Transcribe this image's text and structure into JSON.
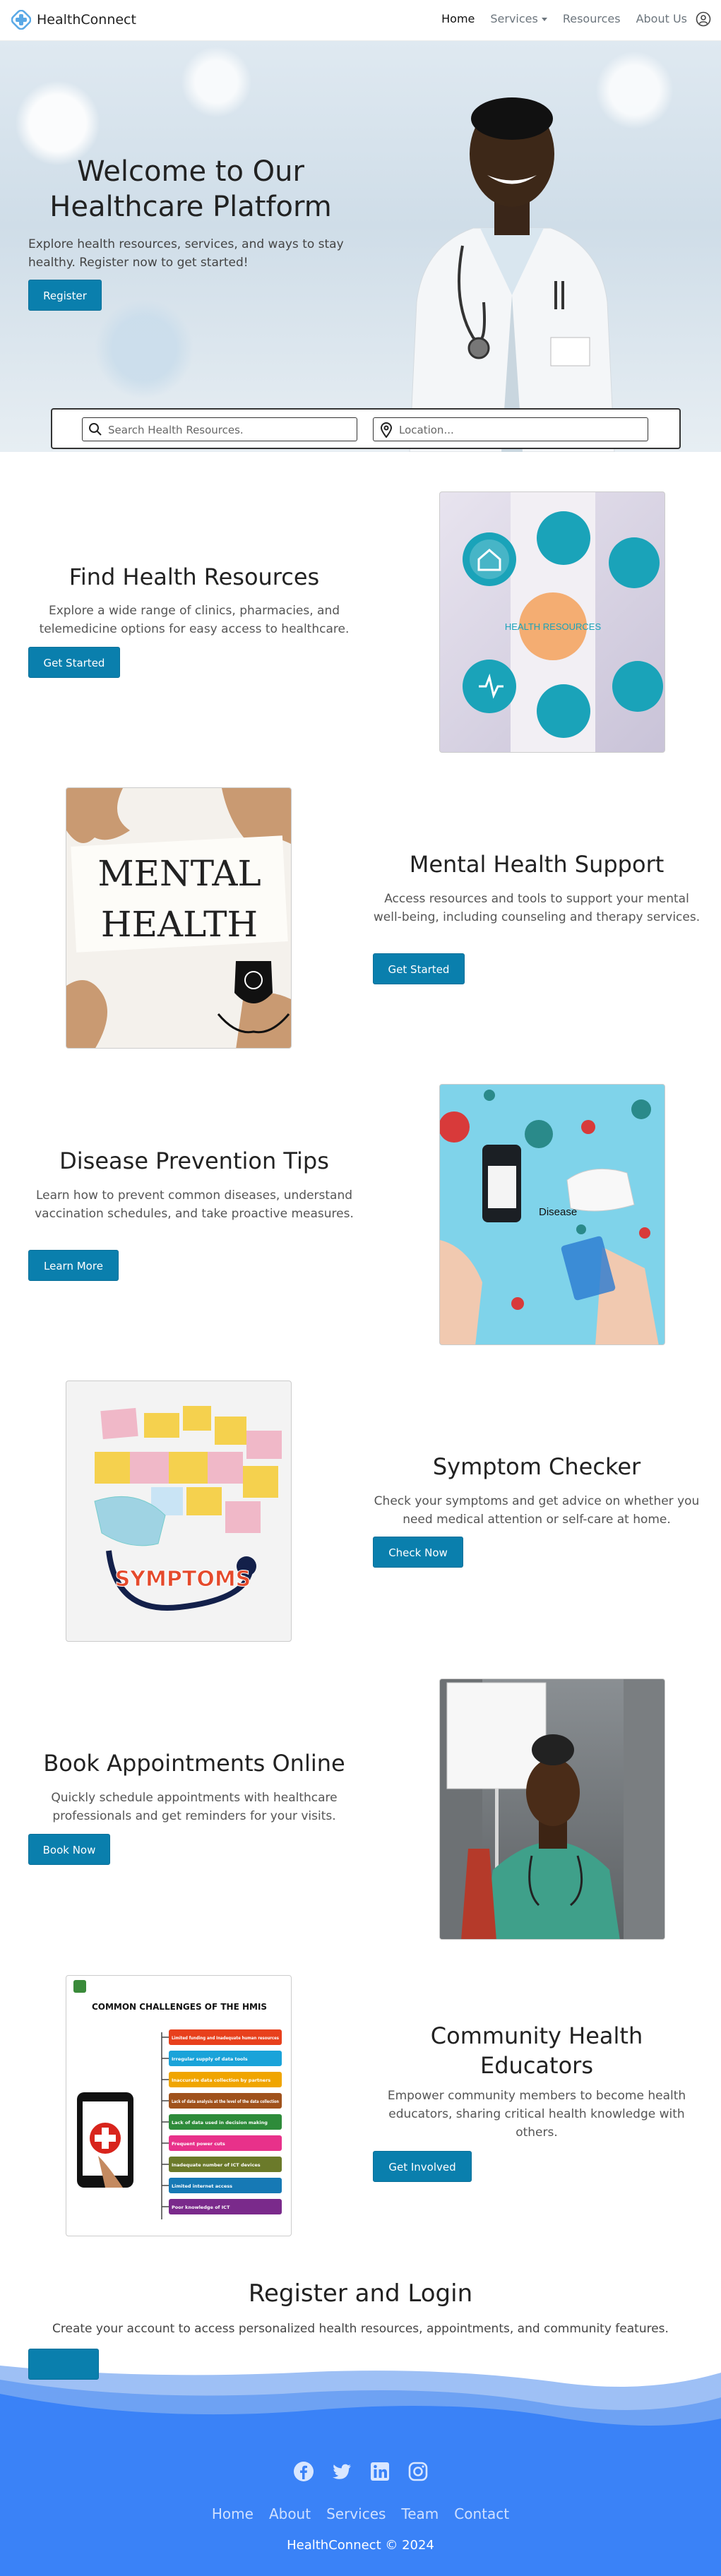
{
  "navbar": {
    "brand": "HealthConnect",
    "links": [
      "Home",
      "Services",
      "Resources",
      "About Us"
    ]
  },
  "hero": {
    "title": "Welcome to Our Healthcare Platform",
    "subtitle": "Explore health resources, services, and ways to stay healthy. Register now to get started!",
    "button": "Register"
  },
  "search": {
    "placeholder": "Search Health Resources.",
    "location_placeholder": "Location..."
  },
  "sections": [
    {
      "title": "Find Health Resources",
      "text": "Explore a wide range of clinics, pharmacies, and telemedicine options for easy access to healthcare.",
      "button": "Get Started",
      "image_caption": "HEALTH RESOURCES"
    },
    {
      "title": "Mental Health Support",
      "text": "Access resources and tools to support your mental well-being, including counseling and therapy services.",
      "button": "Get Started",
      "image_caption_1": "MENTAL",
      "image_caption_2": "HEALTH"
    },
    {
      "title": "Disease Prevention Tips",
      "text": "Learn how to prevent common diseases, understand vaccination schedules, and take proactive measures.",
      "button": "Learn More",
      "image_caption": "Disease"
    },
    {
      "title": "Symptom Checker",
      "text": "Check your symptoms and get advice on whether you need medical attention or self-care at home.",
      "button": "Check Now",
      "image_caption": "SYMPTOMS"
    },
    {
      "title": "Book Appointments Online",
      "text": "Quickly schedule appointments with healthcare professionals and get reminders for your visits.",
      "button": "Book Now"
    },
    {
      "title": "Community Health Educators",
      "text": "Empower community members to become health educators, sharing critical health knowledge with others.",
      "button": "Get Involved"
    }
  ],
  "hmis": {
    "title": "COMMON CHALLENGES OF THE HMIS",
    "items": [
      "Limited funding and Inadequate human resources",
      "Irregular supply of data tools",
      "Inaccurate data collection by partners",
      "Lack of data analysis at the level of the data collection",
      "Lack of data used in decision making",
      "Frequent power cuts",
      "Inadequate number of ICT devices",
      "Limited internet access",
      "Poor knowledge of ICT"
    ],
    "colors": [
      "#e8401c",
      "#1aa3d9",
      "#f0a500",
      "#a0521c",
      "#2e8b3a",
      "#e8318a",
      "#6b7a2a",
      "#1679b5",
      "#7a2a8b"
    ]
  },
  "register": {
    "title": "Register and Login",
    "text": "Create your account to access personalized health resources, appointments, and community features."
  },
  "footer": {
    "links": [
      "Home",
      "About",
      "Services",
      "Team",
      "Contact"
    ],
    "copyright": "HealthConnect © 2024"
  },
  "colors": {
    "primary": "#0a7fad",
    "footer": "#3a82f7"
  }
}
